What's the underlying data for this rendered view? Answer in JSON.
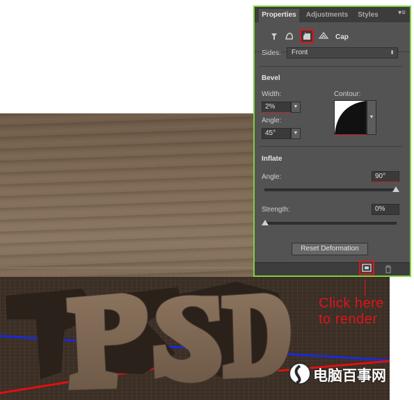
{
  "panel": {
    "tabs": [
      "Properties",
      "Adjustments",
      "Styles"
    ],
    "active_tab": "Properties",
    "tool_icons": [
      "mesh-icon",
      "deform-icon",
      "cap-icon",
      "coordinates-icon"
    ],
    "selected_tool": "cap-icon",
    "section_name": "Cap",
    "sides_label": "Sides:",
    "sides_value": "Front",
    "bevel": {
      "heading": "Bevel",
      "width_label": "Width:",
      "width_value": "2%",
      "angle_label": "Angle:",
      "angle_value": "45°",
      "contour_label": "Contour:"
    },
    "inflate": {
      "heading": "Inflate",
      "angle_label": "Angle:",
      "angle_value": "90°",
      "angle_slider_level": 1.0,
      "strength_label": "Strength:",
      "strength_value": "0%",
      "strength_slider_level": 0.0
    },
    "reset_button": "Reset Deformation",
    "footer_icons": [
      "render-icon",
      "trash-icon"
    ]
  },
  "annotation": {
    "line1": "Click here",
    "line2": "to render"
  },
  "scene": {
    "text_3d": "PSD"
  },
  "watermark": "电脑百事网",
  "colors": {
    "highlight": "#e0141c",
    "panel_border": "#7ed23c",
    "panel_bg": "#535353",
    "axis_red": "#e01010",
    "axis_blue": "#1a2ad8"
  }
}
